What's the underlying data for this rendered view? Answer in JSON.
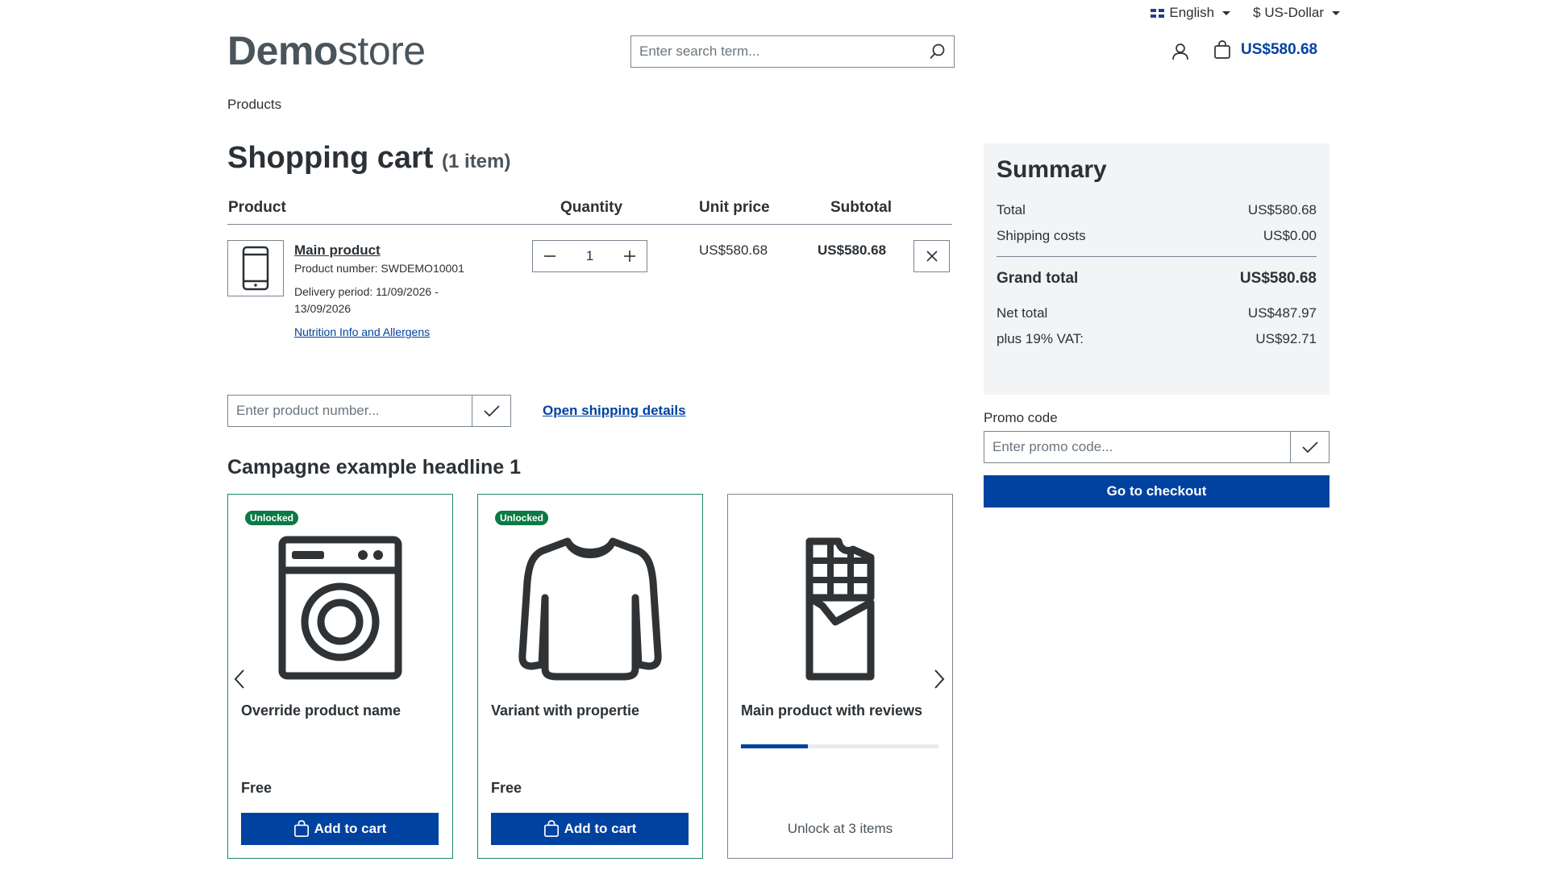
{
  "topbar": {
    "language": "English",
    "currency": "$ US-Dollar"
  },
  "header": {
    "logo_bold": "Demo",
    "logo_light": "store",
    "search_placeholder": "Enter search term...",
    "cart_total": "US$580.68"
  },
  "breadcrumb": {
    "label": "Products"
  },
  "cart": {
    "title": "Shopping cart",
    "count_label": "(1 item)",
    "columns": {
      "product": "Product",
      "quantity": "Quantity",
      "unit_price": "Unit price",
      "subtotal": "Subtotal"
    },
    "item": {
      "name": "Main product",
      "product_number": "Product number: SWDEMO10001",
      "delivery_line1": "Delivery period: 11/09/2026 -",
      "delivery_line2": "13/09/2026",
      "link": "Nutrition Info and Allergens",
      "quantity": "1",
      "unit_price": "US$580.68",
      "subtotal": "US$580.68",
      "icon": "smartphone-icon"
    },
    "product_number_placeholder": "Enter product number...",
    "shipping_link": "Open shipping details"
  },
  "campaign": {
    "headline": "Campagne example headline 1",
    "cards": [
      {
        "badge": "Unlocked",
        "name": "Override product name",
        "price": "Free",
        "button": "Add to cart",
        "icon": "washing-machine-icon"
      },
      {
        "badge": "Unlocked",
        "name": "Variant with propertie",
        "price": "Free",
        "button": "Add to cart",
        "icon": "sweater-icon"
      },
      {
        "name": "Main product with reviews",
        "unlock_text": "Unlock at 3 items",
        "progress_fraction": 0.34,
        "icon": "chocolate-bar-icon"
      }
    ]
  },
  "summary": {
    "title": "Summary",
    "total_label": "Total",
    "total_value": "US$580.68",
    "shipping_label": "Shipping costs",
    "shipping_value": "US$0.00",
    "grand_label": "Grand total",
    "grand_value": "US$580.68",
    "net_label": "Net total",
    "net_value": "US$487.97",
    "vat_label": "plus 19% VAT:",
    "vat_value": "US$92.71"
  },
  "promo": {
    "label": "Promo code",
    "placeholder": "Enter promo code..."
  },
  "checkout": {
    "label": "Go to checkout"
  },
  "colors": {
    "primary": "#0042a0",
    "badge": "#0b7a43",
    "text": "#2b3136",
    "border": "#798490"
  }
}
